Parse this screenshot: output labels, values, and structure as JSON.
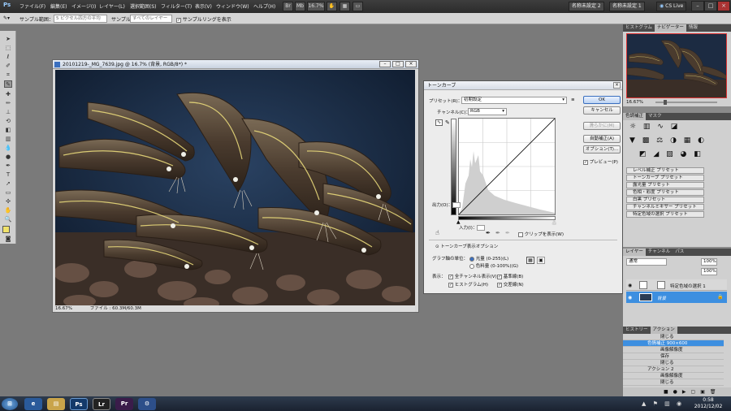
{
  "menu": {
    "logo": "Ps",
    "items": [
      "ファイル(F)",
      "編集(E)",
      "イメージ(I)",
      "レイヤー(L)",
      "選択範囲(S)",
      "フィルター(T)",
      "表示(V)",
      "ウィンドウ(W)",
      "ヘルプ(H)"
    ],
    "zoom": "16.7%",
    "workspaces": [
      "名称未設定 2",
      "名称未設定 1"
    ],
    "cslive": "CS Live"
  },
  "options": {
    "sample_size_label": "サンプル範囲：",
    "sample_size_value": "5 ピクセル四方の平均",
    "sample_label": "サンプル：",
    "sample_value": "すべてのレイヤー",
    "show_ring": "サンプルリングを表示"
  },
  "document": {
    "title": "20101219-_MG_7639.jpg @ 16.7% (背景, RGB/8*) *",
    "zoom": "16.67%",
    "file_info": "ファイル : 60.3M/60.3M"
  },
  "dialog": {
    "title": "トーンカーブ",
    "preset_label": "プリセット(R)：",
    "preset_value": "初期設定",
    "channel_label": "チャンネル(C)：",
    "channel_value": "RGB",
    "output_label": "出力(O)：",
    "input_label": "入力(I)：",
    "clip_label": "クリップを表示(W)",
    "options_section": "トーンカーブ表示オプション",
    "unit_label": "グラフ軸の単位：",
    "unit_light": "光量 (0-255)(L)",
    "unit_pigment": "色料量 (0-100%)(G)",
    "show_label": "表示：",
    "show_channels": "全チャンネル表示(V)",
    "show_baseline": "基準線(B)",
    "show_histogram": "ヒストグラム(H)",
    "show_intersect": "交差線(N)",
    "btn_ok": "OK",
    "btn_cancel": "キャンセル",
    "btn_smooth": "滑らかに(M)",
    "btn_auto": "自動補正(A)",
    "btn_options": "オプション(T)...",
    "preview_label": "プレビュー(P)"
  },
  "panels": {
    "tabs_top": [
      "ヒストグラム",
      "ナビゲーター",
      "情報"
    ],
    "nav_zoom": "16.67%",
    "tabs_adj": [
      "色調補正",
      "マスク"
    ],
    "adj_items": [
      "レベル補正 プリセット",
      "トーンカーブ プリセット",
      "露光量 プリセット",
      "色相・彩度 プリセット",
      "白黒 プリセット",
      "チャンネルミキサー プリセット",
      "特定色域の選択 プリセット"
    ],
    "tabs_layers": [
      "レイヤー",
      "チャンネル",
      "パス"
    ],
    "blend": "通常",
    "opacity": "100%",
    "fill": "100%",
    "layers": [
      "特定色域の選択 1",
      "背景"
    ],
    "tabs_actions": [
      "ヒストリー",
      "アクション"
    ],
    "actions": [
      "閉じる",
      "色情補正 900×600",
      "画像解像度",
      "保存",
      "閉じる",
      "アクション 2",
      "画像解像度",
      "閉じる"
    ]
  },
  "taskbar": {
    "apps": [
      "Ps",
      "Lr",
      "Pr"
    ],
    "time": "0:58",
    "date": "2012/12/02"
  }
}
